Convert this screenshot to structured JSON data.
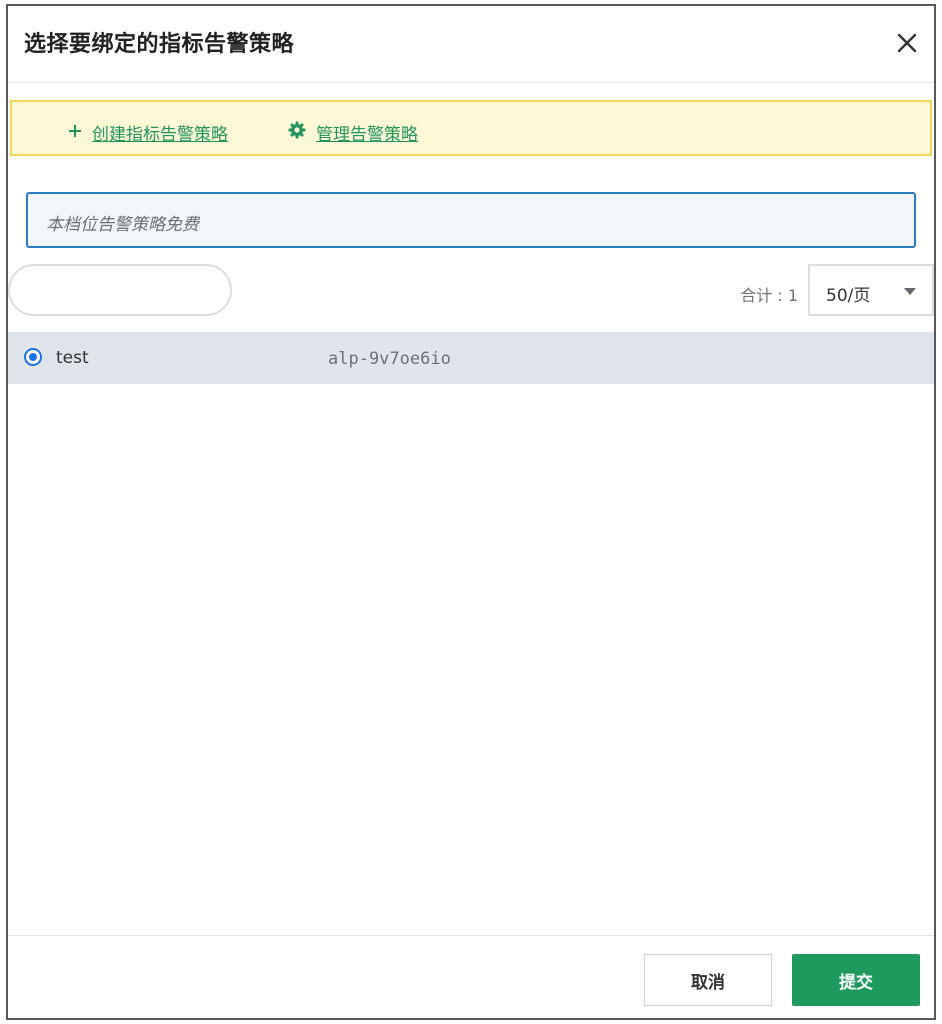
{
  "dialog": {
    "title": "选择要绑定的指标告警策略",
    "close_icon": "close-icon"
  },
  "toolbar": {
    "create_icon": "plus-icon",
    "create_label": "创建指标告警策略",
    "manage_icon": "gear-icon",
    "manage_label": "管理告警策略",
    "link_color": "#22955e"
  },
  "notice": {
    "text": "本档位告警策略免费"
  },
  "list": {
    "search_value": "",
    "total_label": "合计 : 1",
    "page_size": "50/页",
    "rows": [
      {
        "name": "test",
        "id": "alp-9v7oe6io",
        "selected": true
      }
    ]
  },
  "footer": {
    "cancel_label": "取消",
    "submit_label": "提交",
    "submit_color": "#1f9a5f"
  }
}
